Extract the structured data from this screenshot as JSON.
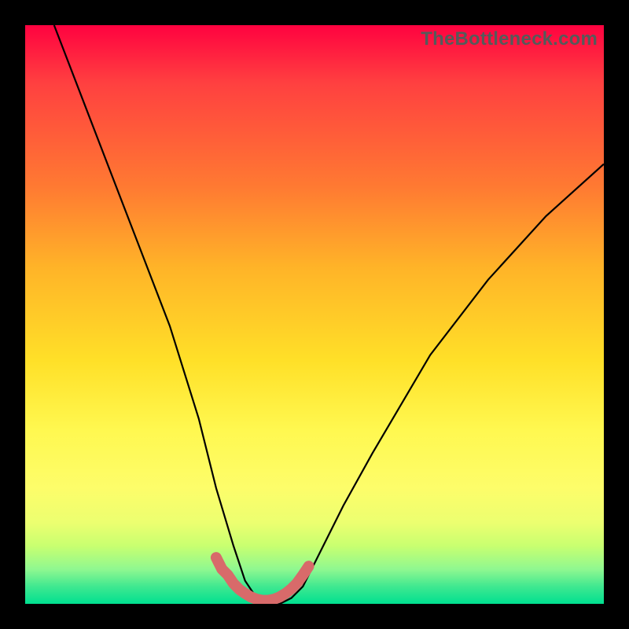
{
  "watermark": "TheBottleneck.com",
  "chart_data": {
    "type": "line",
    "title": "",
    "xlabel": "",
    "ylabel": "",
    "xlim": [
      0,
      100
    ],
    "ylim": [
      0,
      100
    ],
    "series": [
      {
        "name": "bottleneck-curve",
        "x": [
          5,
          10,
          15,
          20,
          25,
          30,
          33,
          36,
          38,
          40,
          42,
          44,
          46,
          48,
          50,
          55,
          60,
          70,
          80,
          90,
          100
        ],
        "y": [
          100,
          87,
          74,
          61,
          48,
          32,
          20,
          10,
          4,
          1,
          0,
          0,
          1,
          3,
          7,
          17,
          26,
          43,
          56,
          67,
          76
        ]
      }
    ],
    "valley_marker": {
      "name": "optimal-range",
      "x": [
        33,
        34,
        35,
        36,
        37,
        38,
        39,
        40,
        41,
        42,
        43,
        44,
        45,
        46,
        47,
        48,
        49
      ],
      "y": [
        8,
        6,
        5,
        3.5,
        2.5,
        1.8,
        1.2,
        0.8,
        0.6,
        0.6,
        0.8,
        1.2,
        1.8,
        2.6,
        3.6,
        5,
        6.5
      ]
    },
    "colors": {
      "curve": "#000000",
      "valley_marker": "#d86a6a",
      "gradient_top": "#ff0240",
      "gradient_bottom": "#00e090"
    }
  }
}
